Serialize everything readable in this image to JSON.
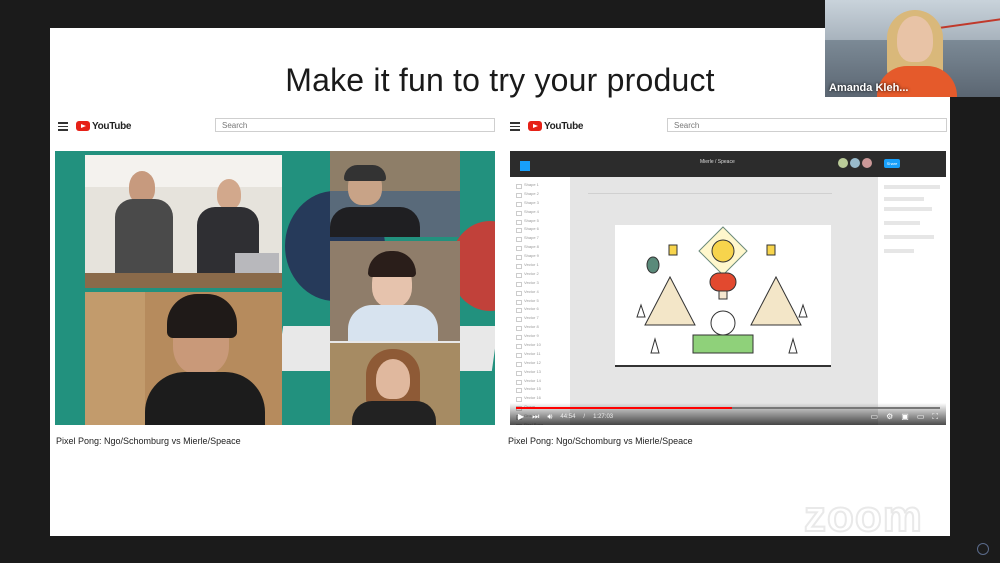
{
  "slide": {
    "title": "Make it fun to try your product"
  },
  "videos": [
    {
      "brand": "YouTube",
      "search_placeholder": "Search",
      "caption": "Pixel Pong: Ngo/Schomburg vs Mierle/Speace"
    },
    {
      "brand": "YouTube",
      "search_placeholder": "Search",
      "caption": "Pixel Pong: Ngo/Schomburg vs Mierle/Speace",
      "player": {
        "current_time": "44:54",
        "duration": "1:27:03",
        "progress_fraction": 0.51
      },
      "figma": {
        "file_title": "Mierle / Speace",
        "share_label": "Share",
        "layers": [
          "Shape 1",
          "Shape 2",
          "Shape 3",
          "Shape 4",
          "Shape 5",
          "Shape 6",
          "Shape 7",
          "Shape 8",
          "Shape 9",
          "Vector 1",
          "Vector 2",
          "Vector 3",
          "Vector 4",
          "Vector 5",
          "Vector 6",
          "Vector 7",
          "Vector 8",
          "Vector 9",
          "Vector 10",
          "Vector 11",
          "Vector 12",
          "Vector 13",
          "Vector 14",
          "Vector 15",
          "Vector 16",
          "Group",
          "Group",
          "Pixel Pong"
        ]
      }
    }
  ],
  "zoom_call": {
    "participant_name": "Amanda Kleh...",
    "watermark": "zoom"
  },
  "colors": {
    "teal": "#22917e",
    "youtube_red": "#e62117",
    "figma_dark": "#2c2c2c",
    "figma_blue": "#18a0fb"
  }
}
